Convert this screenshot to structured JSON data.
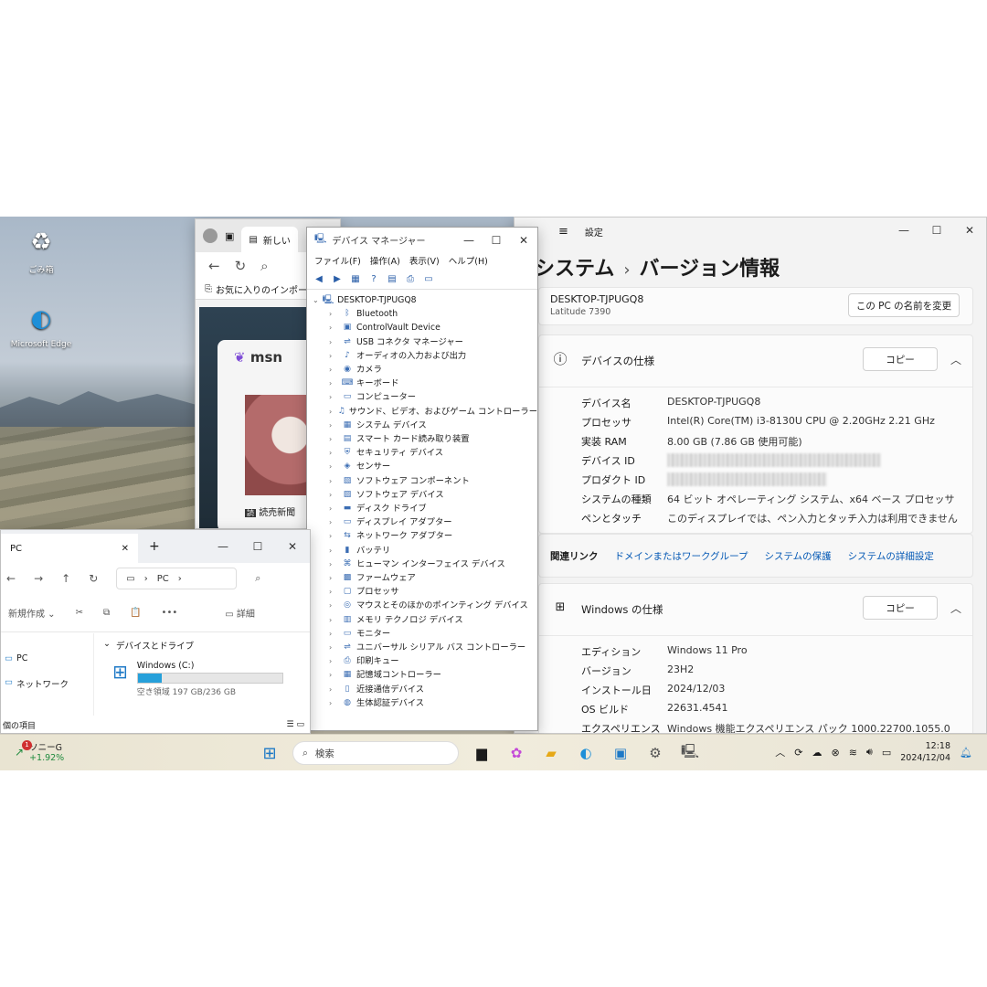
{
  "desktop": {
    "icons": [
      {
        "label": "ごみ箱",
        "glyph": "recycle-bin-icon"
      },
      {
        "label": "Microsoft Edge",
        "glyph": "edge-icon"
      }
    ]
  },
  "edge": {
    "tab_label": "新しい",
    "favorites_label": "お気に入りのインポート",
    "msn_logo": "msn",
    "news_label": "読売新聞"
  },
  "device_manager": {
    "title": "デバイス マネージャー",
    "menu": [
      "ファイル(F)",
      "操作(A)",
      "表示(V)",
      "ヘルプ(H)"
    ],
    "root": "DESKTOP-TJPUGQ8",
    "items": [
      "Bluetooth",
      "ControlVault Device",
      "USB コネクタ マネージャー",
      "オーディオの入力および出力",
      "カメラ",
      "キーボード",
      "コンピューター",
      "サウンド、ビデオ、およびゲーム コントローラー",
      "システム デバイス",
      "スマート カード読み取り装置",
      "セキュリティ デバイス",
      "センサー",
      "ソフトウェア コンポーネント",
      "ソフトウェア デバイス",
      "ディスク ドライブ",
      "ディスプレイ アダプター",
      "ネットワーク アダプター",
      "バッテリ",
      "ヒューマン インターフェイス デバイス",
      "ファームウェア",
      "プロセッサ",
      "マウスとそのほかのポインティング デバイス",
      "メモリ テクノロジ デバイス",
      "モニター",
      "ユニバーサル シリアル バス コントローラー",
      "印刷キュー",
      "記憶域コントローラー",
      "近接通信デバイス",
      "生体認証デバイス"
    ]
  },
  "settings": {
    "app_title": "設定",
    "breadcrumb_parent": "システム",
    "breadcrumb_sep": "›",
    "breadcrumb_current": "バージョン情報",
    "pc_name": "DESKTOP-TJPUGQ8",
    "pc_model": "Latitude 7390",
    "rename_button": "この PC の名前を変更",
    "device_spec": {
      "title": "デバイスの仕様",
      "copy_button": "コピー",
      "rows": [
        {
          "k": "デバイス名",
          "v": "DESKTOP-TJPUGQ8"
        },
        {
          "k": "プロセッサ",
          "v": "Intel(R) Core(TM) i3-8130U CPU @ 2.20GHz   2.21 GHz"
        },
        {
          "k": "実装 RAM",
          "v": "8.00 GB (7.86 GB 使用可能)"
        },
        {
          "k": "デバイス ID",
          "v": ""
        },
        {
          "k": "プロダクト ID",
          "v": ""
        },
        {
          "k": "システムの種類",
          "v": "64 ビット オペレーティング システム、x64 ベース プロセッサ"
        },
        {
          "k": "ペンとタッチ",
          "v": "このディスプレイでは、ペン入力とタッチ入力は利用できません"
        }
      ]
    },
    "related_links": {
      "label": "関連リンク",
      "links": [
        "ドメインまたはワークグループ",
        "システムの保護",
        "システムの詳細設定"
      ]
    },
    "windows_spec": {
      "title": "Windows の仕様",
      "copy_button": "コピー",
      "rows": [
        {
          "k": "エディション",
          "v": "Windows 11 Pro"
        },
        {
          "k": "バージョン",
          "v": "23H2"
        },
        {
          "k": "インストール日",
          "v": "2024/12/03"
        },
        {
          "k": "OS ビルド",
          "v": "22631.4541"
        },
        {
          "k": "エクスペリエンス",
          "v": "Windows 機能エクスペリエンス パック 1000.22700.1055.0"
        }
      ]
    }
  },
  "explorer": {
    "tab_label": "PC",
    "address": [
      "PC"
    ],
    "new_button": "新規作成",
    "details_button": "詳細",
    "sidebar": [
      "PC",
      "ネットワーク"
    ],
    "group_label": "デバイスとドライブ",
    "drive_name": "Windows (C:)",
    "drive_free": "空き領域 197 GB/236 GB",
    "drive_used_fraction": 0.165,
    "status_left": "個の項目"
  },
  "taskbar": {
    "stock_name": "ソニーG",
    "stock_change": "+1.92%",
    "stock_badge": "1",
    "search_placeholder": "検索",
    "time": "12:18",
    "date": "2024/12/04"
  }
}
